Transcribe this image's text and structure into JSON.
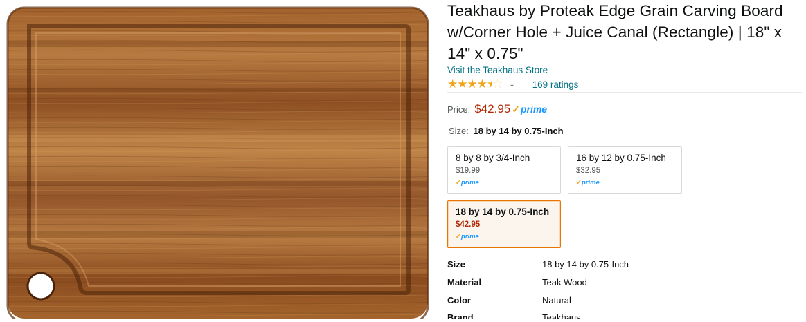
{
  "product": {
    "title": "Teakhaus by Proteak Edge Grain Carving Board w/Corner Hole + Juice Canal (Rectangle) | 18\" x 14\" x 0.75\"",
    "title_lines": [
      "Teakhaus by Proteak Edge Grain Carving Board",
      "w/Corner Hole + Juice Canal (Rectangle) | 18\" x",
      "14\" x 0.75\""
    ],
    "store_link": "Visit the Teakhaus Store",
    "rating_stars": 4.5,
    "ratings_count": "169 ratings",
    "price_label": "Price:",
    "price": "$42.95",
    "prime": "prime",
    "size_label": "Size:",
    "size_selected": "18 by 14 by 0.75-Inch"
  },
  "swatches": [
    {
      "name": "8 by 8 by 3/4-Inch",
      "price": "$19.99",
      "prime": "prime",
      "selected": false
    },
    {
      "name": "16 by 12 by 0.75-Inch",
      "price": "$32.95",
      "prime": "prime",
      "selected": false
    },
    {
      "name": "18 by 14 by 0.75-Inch",
      "price": "$42.95",
      "prime": "prime",
      "selected": true
    }
  ],
  "specs": [
    {
      "key": "Size",
      "value": "18 by 14 by 0.75-Inch"
    },
    {
      "key": "Material",
      "value": "Teak Wood"
    },
    {
      "key": "Color",
      "value": "Natural"
    },
    {
      "key": "Brand",
      "value": "Teakhaus"
    }
  ],
  "colors": {
    "link": "#007185",
    "price": "#b12704",
    "star": "#f0a41b",
    "prime": "#1a98ff",
    "wood_light": "#b8743a",
    "wood_dark": "#6e3a15"
  }
}
